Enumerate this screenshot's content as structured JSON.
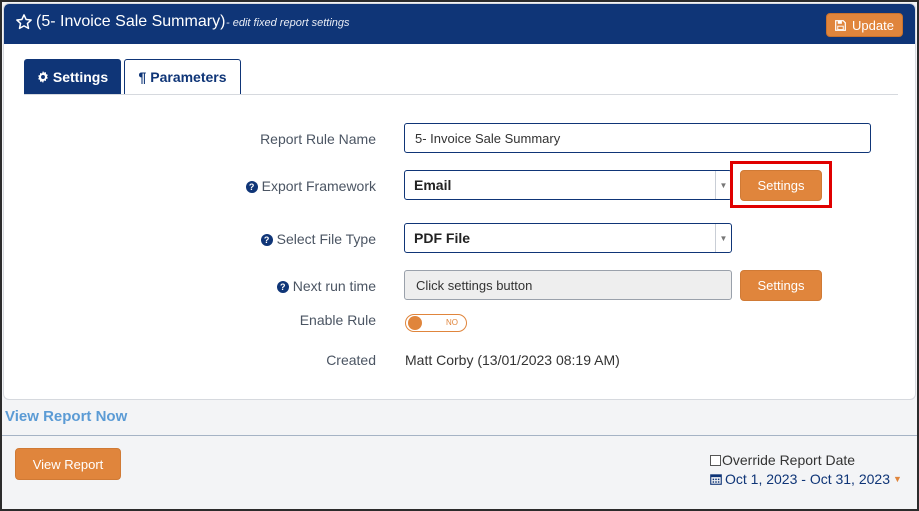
{
  "header": {
    "title": "(5- Invoice Sale Summary)",
    "subtitle": "- edit fixed report settings",
    "update_label": "Update"
  },
  "tabs": [
    {
      "label": "Settings",
      "icon": "gear-icon",
      "active": true
    },
    {
      "label": "Parameters",
      "icon": "pilcrow-icon",
      "active": false
    }
  ],
  "form": {
    "report_rule_name_label": "Report Rule Name",
    "report_rule_name_value": "5- Invoice Sale Summary",
    "export_framework_label": "Export Framework",
    "export_framework_value": "Email",
    "export_settings_label": "Settings",
    "file_type_label": "Select File Type",
    "file_type_value": "PDF File",
    "next_run_label": "Next run time",
    "next_run_value": "Click settings button",
    "next_run_settings_label": "Settings",
    "enable_rule_label": "Enable Rule",
    "enable_rule_state": "NO",
    "created_label": "Created",
    "created_value": "Matt Corby (13/01/2023 08:19 AM)"
  },
  "footer": {
    "view_report_now": "View Report Now",
    "view_report_button": "View Report",
    "override_label": "Override Report Date",
    "date_range": "Oct 1, 2023 - Oct 31, 2023"
  },
  "colors": {
    "header_bg": "#0f3577",
    "accent_orange": "#e0853c",
    "highlight_red": "#e00000",
    "link_blue": "#5b9bd5"
  }
}
